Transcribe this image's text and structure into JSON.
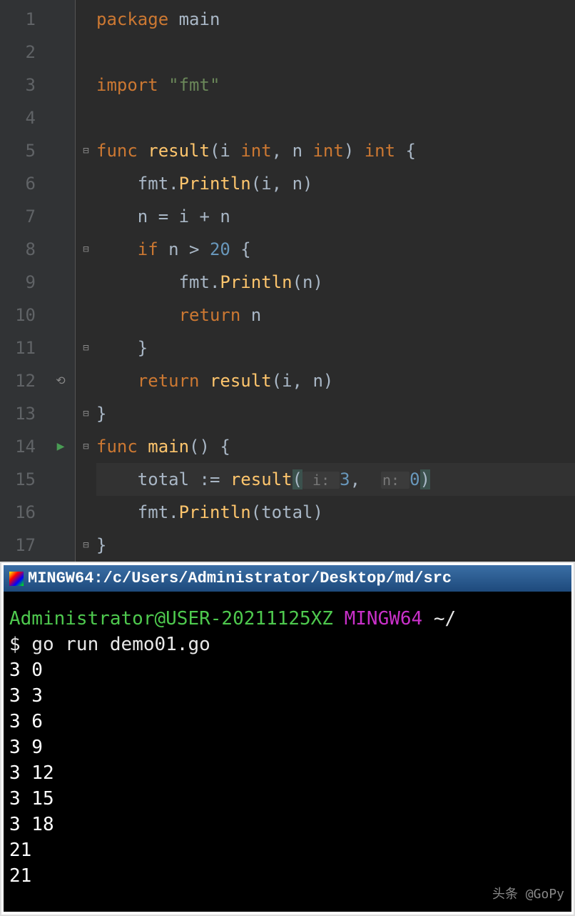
{
  "editor": {
    "lines": [
      {
        "num": "1"
      },
      {
        "num": "2"
      },
      {
        "num": "3"
      },
      {
        "num": "4"
      },
      {
        "num": "5"
      },
      {
        "num": "6"
      },
      {
        "num": "7"
      },
      {
        "num": "8"
      },
      {
        "num": "9"
      },
      {
        "num": "10"
      },
      {
        "num": "11"
      },
      {
        "num": "12"
      },
      {
        "num": "13"
      },
      {
        "num": "14"
      },
      {
        "num": "15"
      },
      {
        "num": "16"
      },
      {
        "num": "17"
      }
    ],
    "code": {
      "l1_kw": "package",
      "l1_id": "main",
      "l3_kw": "import",
      "l3_str": "\"fmt\"",
      "l5_kw": "func",
      "l5_fn": "result",
      "l5_sig": "(i ",
      "l5_int1": "int",
      "l5_mid": ", n ",
      "l5_int2": "int",
      "l5_end": ") ",
      "l5_int3": "int",
      "l5_brace": " {",
      "l6_obj": "fmt",
      "l6_dot": ".",
      "l6_fn": "Println",
      "l6_args": "(i, n)",
      "l7": "n = i + n",
      "l8_kw": "if",
      "l8_cond": " n > ",
      "l8_num": "20",
      "l8_brace": " {",
      "l9_obj": "fmt",
      "l9_dot": ".",
      "l9_fn": "Println",
      "l9_args": "(n)",
      "l10_kw": "return",
      "l10_val": " n",
      "l11": "}",
      "l12_kw": "return",
      "l12_fn": "result",
      "l12_args": "(i, n)",
      "l13": "}",
      "l14_kw": "func",
      "l14_fn": "main",
      "l14_sig": "() {",
      "l15_var": "total := ",
      "l15_fn": "result",
      "l15_p1": "(",
      "l15_h1": " i: ",
      "l15_a1": "3",
      "l15_c": ",  ",
      "l15_h2": "n: ",
      "l15_a2": "0",
      "l15_p2": ")",
      "l16_obj": "fmt",
      "l16_dot": ".",
      "l16_fn": "Println",
      "l16_args": "(total)",
      "l17": "}"
    }
  },
  "terminal": {
    "title": "MINGW64:/c/Users/Administrator/Desktop/md/src",
    "prompt_user": "Administrator@USER",
    "prompt_host": "-20211125XZ",
    "prompt_env": " MINGW64 ",
    "prompt_path": "~/",
    "dollar": "$ ",
    "command": "go run demo01.go",
    "output": [
      "3 0",
      "3 3",
      "3 6",
      "3 9",
      "3 12",
      "3 15",
      "3 18",
      "21",
      "21"
    ],
    "watermark": "头条 @GoPy"
  }
}
